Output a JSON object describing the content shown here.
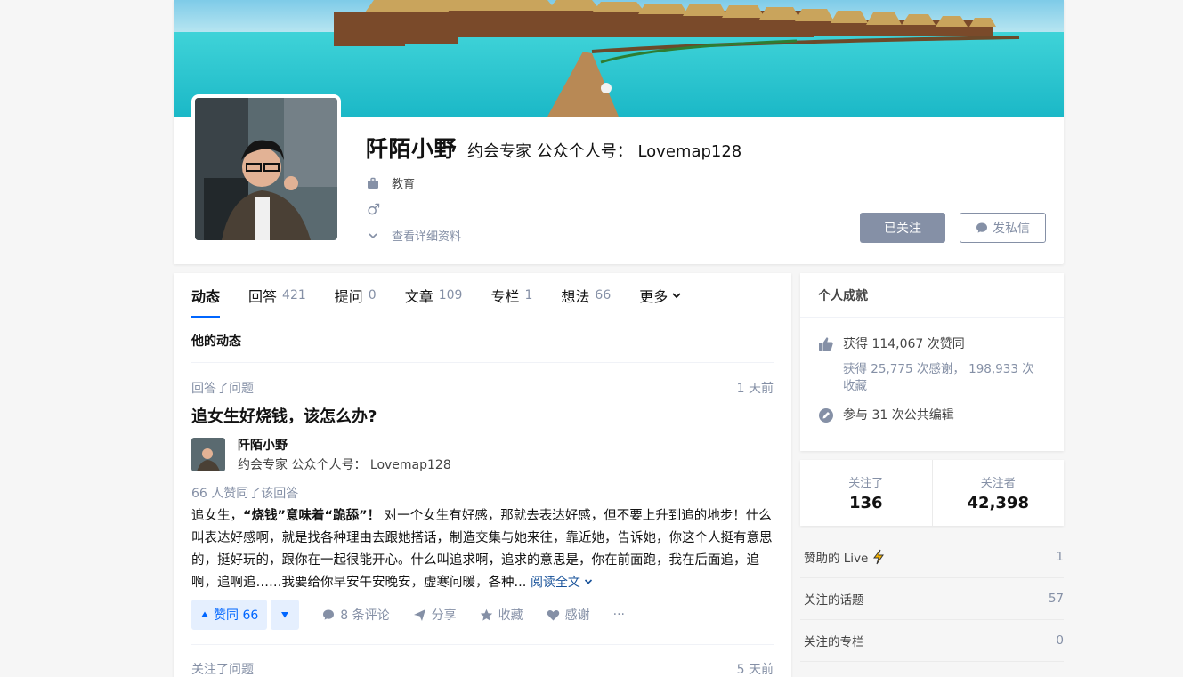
{
  "profile": {
    "name": "阡陌小野",
    "headline": "约会专家 公众个人号： Lovemap128",
    "industry": "教育",
    "gender_symbol": "♂",
    "detail_link": "查看详细资料",
    "follow_button": "已关注",
    "message_button": "发私信"
  },
  "tabs": [
    {
      "label": "动态",
      "count": ""
    },
    {
      "label": "回答",
      "count": "421"
    },
    {
      "label": "提问",
      "count": "0"
    },
    {
      "label": "文章",
      "count": "109"
    },
    {
      "label": "专栏",
      "count": "1"
    },
    {
      "label": "想法",
      "count": "66"
    },
    {
      "label": "更多",
      "count": ""
    }
  ],
  "feed": {
    "section_title": "他的动态",
    "item1": {
      "action": "回答了问题",
      "time": "1 天前",
      "question": "追女生好烧钱，该怎么办?",
      "author_name": "阡陌小野",
      "author_headline": "约会专家 公众个人号： Lovemap128",
      "voters": "66 人赞同了该回答",
      "excerpt_prefix": "追女生，",
      "excerpt_bold": "“烧钱”意味着“跪舔”！",
      "excerpt_rest": " 对一个女生有好感，那就去表达好感，但不要上升到追的地步！什么叫表达好感啊，就是找各种理由去跟她搭话，制造交集与她来往，靠近她，告诉她，你这个人挺有意思的，挺好玩的，跟你在一起很能开心。什么叫追求啊，追求的意思是，你在前面跑，我在后面追，追啊，追啊追……我要给你早安午安晚安，虚寒问暖，各种...",
      "read_more": "阅读全文",
      "vote_label": "赞同 66",
      "comments": "8 条评论",
      "share": "分享",
      "collect": "收藏",
      "thanks": "感谢",
      "more": "···"
    },
    "item2": {
      "action": "关注了问题",
      "time": "5 天前"
    }
  },
  "achievements": {
    "title": "个人成就",
    "likes": "获得 114,067 次赞同",
    "thanks_collect": "获得 25,775 次感谢， 198,933 次收藏",
    "edits": "参与 31 次公共编辑"
  },
  "follow_stats": {
    "following_label": "关注了",
    "following_count": "136",
    "followers_label": "关注者",
    "followers_count": "42,398"
  },
  "side_list": [
    {
      "label": "赞助的 Live",
      "value": "1"
    },
    {
      "label": "关注的话题",
      "value": "57"
    },
    {
      "label": "关注的专栏",
      "value": "0"
    }
  ],
  "colors": {
    "accent": "#0066ff",
    "muted": "#8590a6",
    "vote_bg": "#e5effe"
  }
}
